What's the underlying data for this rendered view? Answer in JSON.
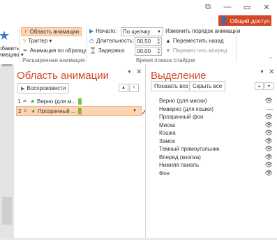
{
  "window": {
    "restore_icon": "restore-down-icon",
    "minimize_label": "—",
    "maximize_label": "▭",
    "close_label": "✕",
    "restore_label": "⧉"
  },
  "share": {
    "label": "Общий доступ",
    "color": "#d24726"
  },
  "ribbon": {
    "add_animation": {
      "line1": "обавить",
      "line2": "имацию ▾"
    },
    "advanced": {
      "animation_pane": "Область анимации",
      "trigger": "Триггер ▾",
      "painter": "Анимация по образцу",
      "group_label": "Расширенная анимация"
    },
    "timing": {
      "start_label": "Начало:",
      "start_value": "По щелчку",
      "duration_label": "Длительность:",
      "duration_value": "00,50",
      "delay_label": "Задержка:",
      "delay_value": "00,00",
      "reorder_title": "Изменить порядок анимации",
      "move_back": "Переместить назад",
      "move_forward": "Переместить вперед",
      "group_label": "Время показа слайдов"
    }
  },
  "animation_pane": {
    "title": "Область анимации",
    "play_button": "Воспроизвести",
    "items": [
      {
        "index": "1",
        "label": "Верно (для м...",
        "selected": false
      },
      {
        "index": "2",
        "label": "Прозрачный ...",
        "selected": true
      }
    ]
  },
  "selection_pane": {
    "title": "Выделение",
    "show_all": "Показать все",
    "hide_all": "Скрыть все",
    "items": [
      {
        "label": "Верно (для миски)",
        "visible": true
      },
      {
        "label": "Неверно (для кошки)",
        "visible": false
      },
      {
        "label": "Прозрачный фон",
        "visible": true
      },
      {
        "label": "Миска",
        "visible": true
      },
      {
        "label": "Кошка",
        "visible": true
      },
      {
        "label": "Замок",
        "visible": true
      },
      {
        "label": "Темный прямоугольник",
        "visible": true
      },
      {
        "label": "Вперед (кнопка)",
        "visible": true
      },
      {
        "label": "Нижняя панель",
        "visible": true
      },
      {
        "label": "Фон",
        "visible": true
      }
    ]
  },
  "colors": {
    "accent": "#d24726",
    "selection_highlight": "#fcd5b4",
    "star_green": "#4ea72e",
    "effect_green": "#7fbf3f"
  }
}
